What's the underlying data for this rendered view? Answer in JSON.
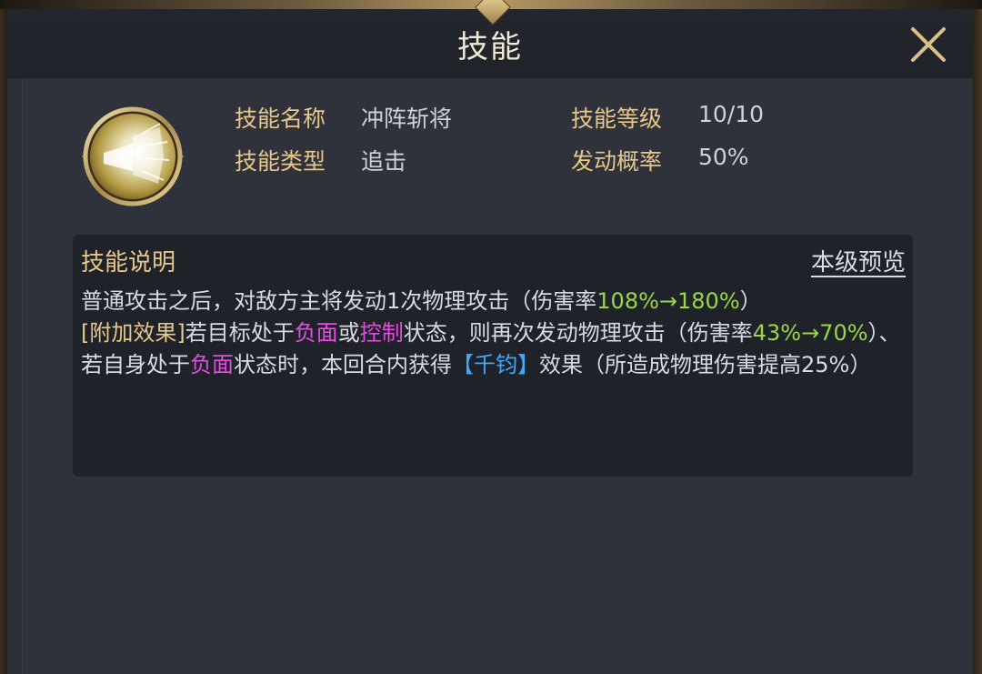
{
  "window": {
    "title": "技能",
    "close_icon": "close-icon"
  },
  "skill": {
    "icon": "skill-burst-icon",
    "name_label": "技能名称",
    "name_value": "冲阵斩将",
    "level_label": "技能等级",
    "level_value": "10/10",
    "type_label": "技能类型",
    "type_value": "追击",
    "chance_label": "发动概率",
    "chance_value": "50%"
  },
  "description": {
    "title": "技能说明",
    "preview_link": "本级预览",
    "line1_text": "普通攻击之后，对敌方主将发动1次物理攻击（伤害率",
    "line1_rate": "108%→180%",
    "line1_close": "）",
    "extra_tag": "[附加效果]",
    "cond_a": "若目标处于",
    "neg1": "负面",
    "or": "或",
    "ctrl": "控制",
    "cond_b": "状态，则再次发动物理攻击（伤害率",
    "rate2": "43%→70%",
    "cond_c": "）、若自身处于",
    "neg2": "负面",
    "cond_d": "状态时，本回合内获得",
    "buff": "【千钧】",
    "cond_e": "效果（所造成物理伤害提高25%）"
  },
  "colors": {
    "gold_label": "#e6c88a",
    "value_text": "#cfd2d8",
    "rate_green": "#9ad64a",
    "status_pink": "#e24fe0",
    "buff_blue": "#3fa9f5",
    "panel_bg": "#2d3038",
    "desc_bg": "#1f2228"
  }
}
